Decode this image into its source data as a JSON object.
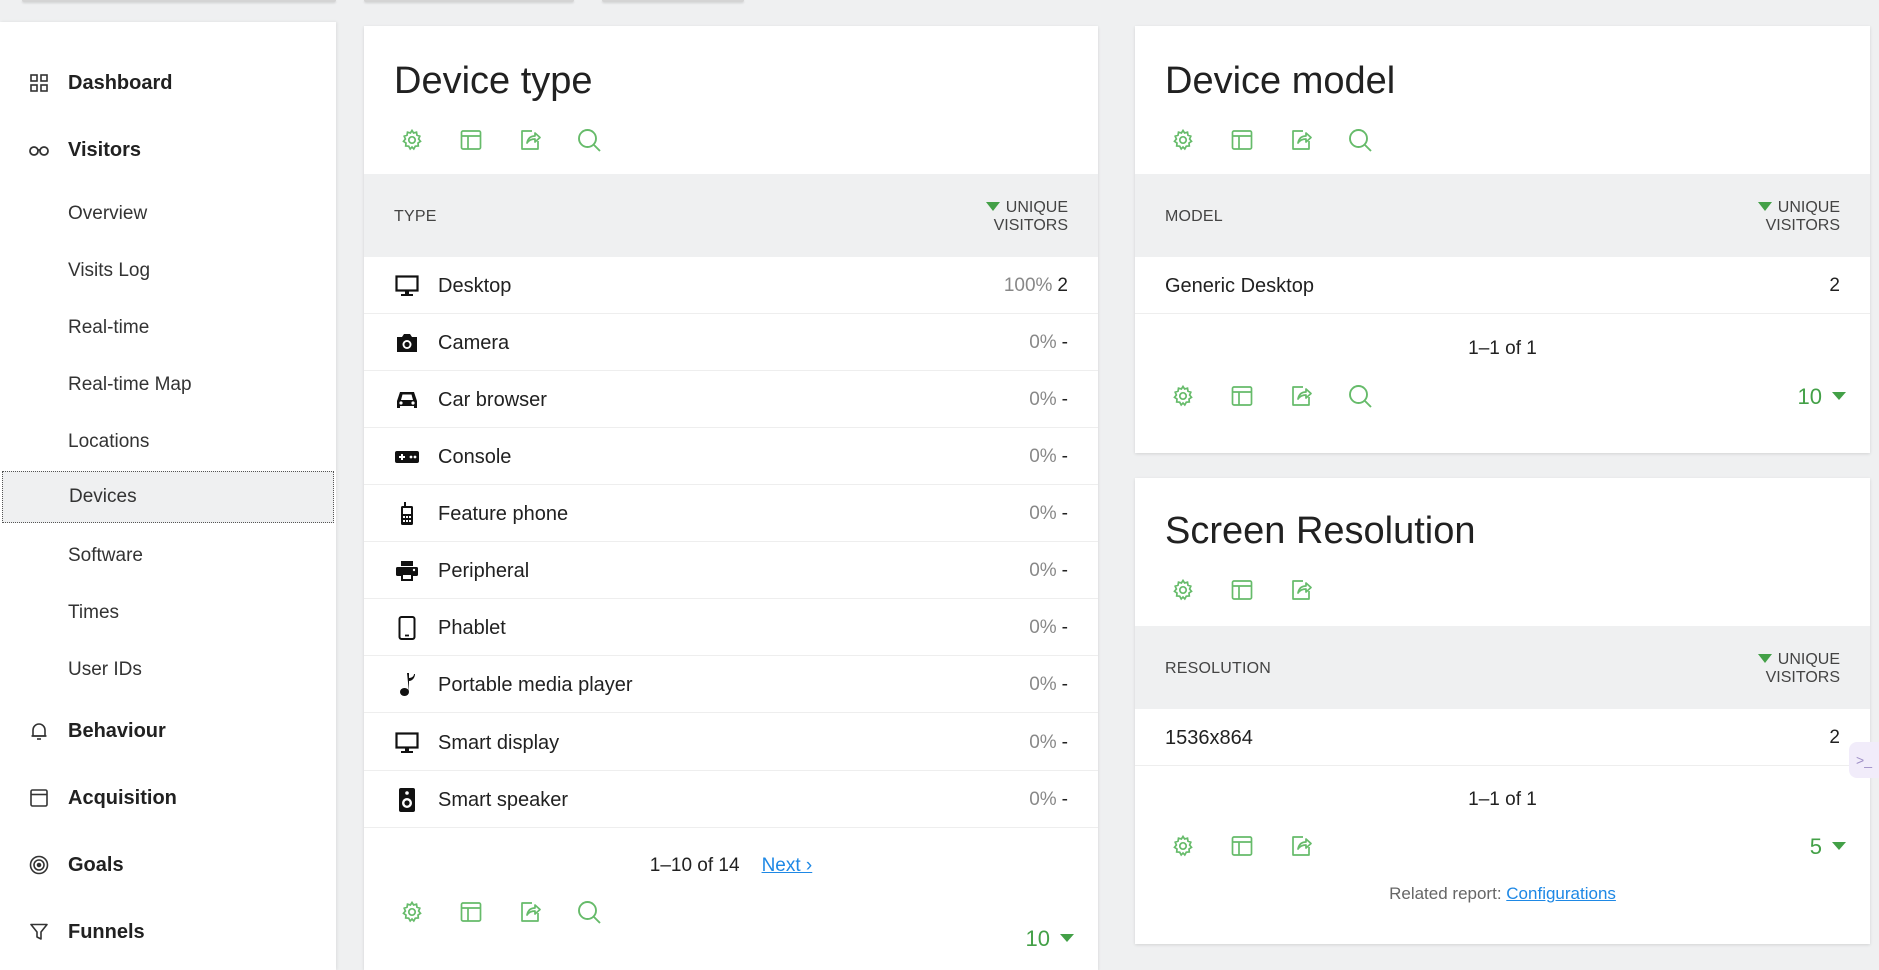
{
  "sidebar": {
    "sections": [
      {
        "label": "Dashboard",
        "icon": "dashboard-grid-icon"
      },
      {
        "label": "Visitors",
        "icon": "binoculars-icon"
      },
      {
        "label": "Behaviour",
        "icon": "bell-icon"
      },
      {
        "label": "Acquisition",
        "icon": "window-icon"
      },
      {
        "label": "Goals",
        "icon": "target-icon"
      },
      {
        "label": "Funnels",
        "icon": "funnel-icon"
      }
    ],
    "visitor_items": [
      {
        "label": "Overview"
      },
      {
        "label": "Visits Log"
      },
      {
        "label": "Real-time"
      },
      {
        "label": "Real-time Map"
      },
      {
        "label": "Locations"
      },
      {
        "label": "Devices",
        "active": true
      },
      {
        "label": "Software"
      },
      {
        "label": "Times"
      },
      {
        "label": "User IDs"
      }
    ]
  },
  "device_type": {
    "title": "Device type",
    "col_left": "Type",
    "col_right_line1": "Unique",
    "col_right_line2": "Visitors",
    "rows": [
      {
        "label": "Desktop",
        "pct": "100%",
        "value": "2",
        "icon": "desktop-icon"
      },
      {
        "label": "Camera",
        "pct": "0%",
        "value": "-",
        "icon": "camera-icon"
      },
      {
        "label": "Car browser",
        "pct": "0%",
        "value": "-",
        "icon": "car-icon"
      },
      {
        "label": "Console",
        "pct": "0%",
        "value": "-",
        "icon": "gamepad-icon"
      },
      {
        "label": "Feature phone",
        "pct": "0%",
        "value": "-",
        "icon": "feature-phone-icon"
      },
      {
        "label": "Peripheral",
        "pct": "0%",
        "value": "-",
        "icon": "printer-icon"
      },
      {
        "label": "Phablet",
        "pct": "0%",
        "value": "-",
        "icon": "phablet-icon"
      },
      {
        "label": "Portable media player",
        "pct": "0%",
        "value": "-",
        "icon": "music-note-icon"
      },
      {
        "label": "Smart display",
        "pct": "0%",
        "value": "-",
        "icon": "smart-display-icon"
      },
      {
        "label": "Smart speaker",
        "pct": "0%",
        "value": "-",
        "icon": "speaker-icon"
      }
    ],
    "pagination": "1–10 of 14",
    "next_label": "Next ›",
    "limit": "10"
  },
  "device_model": {
    "title": "Device model",
    "col_left": "Model",
    "col_right_line1": "Unique",
    "col_right_line2": "Visitors",
    "rows": [
      {
        "label": "Generic Desktop",
        "value": "2"
      }
    ],
    "pagination": "1–1 of 1",
    "limit": "10"
  },
  "screen_resolution": {
    "title": "Screen Resolution",
    "col_left": "Resolution",
    "col_right_line1": "Unique",
    "col_right_line2": "Visitors",
    "rows": [
      {
        "label": "1536x864",
        "value": "2"
      }
    ],
    "pagination": "1–1 of 1",
    "limit": "5",
    "related_prefix": "Related report: ",
    "related_link": "Configurations"
  },
  "colors": {
    "accent_green": "#43a047",
    "link_blue": "#1e88e5",
    "header_gray": "#eff0f1"
  }
}
